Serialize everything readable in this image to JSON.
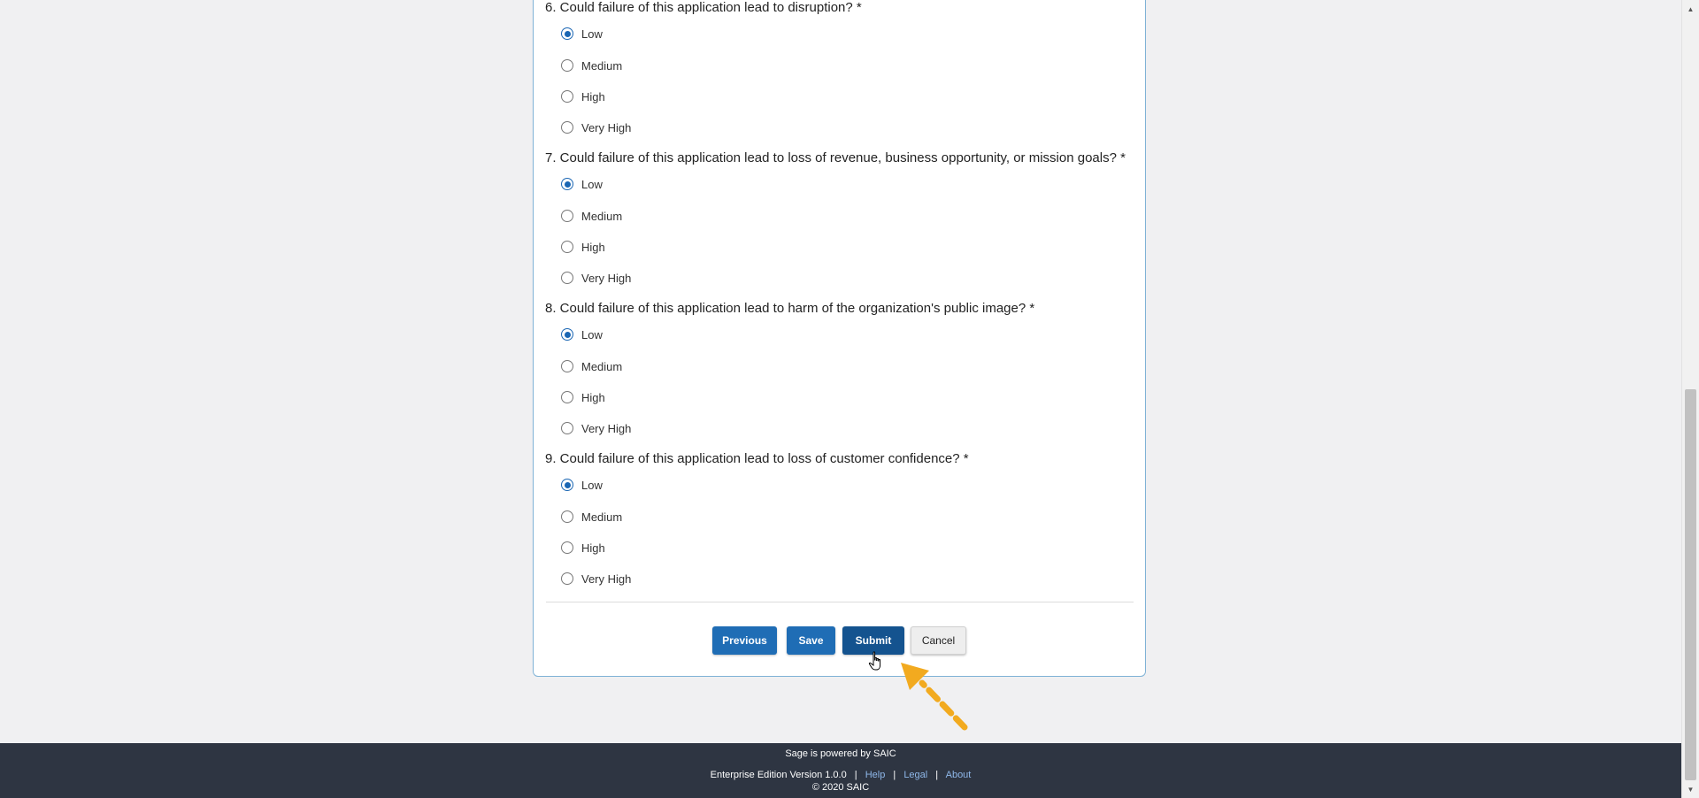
{
  "questions": [
    {
      "title": "6. Could failure of this application lead to disruption? *",
      "options": [
        "Low",
        "Medium",
        "High",
        "Very High"
      ],
      "selected": "Low"
    },
    {
      "title": "7. Could failure of this application lead to loss of revenue, business opportunity, or mission goals? *",
      "options": [
        "Low",
        "Medium",
        "High",
        "Very High"
      ],
      "selected": "Low"
    },
    {
      "title": "8. Could failure of this application lead to harm of the organization's public image? *",
      "options": [
        "Low",
        "Medium",
        "High",
        "Very High"
      ],
      "selected": "Low"
    },
    {
      "title": "9. Could failure of this application lead to loss of customer confidence? *",
      "options": [
        "Low",
        "Medium",
        "High",
        "Very High"
      ],
      "selected": "Low"
    }
  ],
  "buttons": {
    "previous": "Previous",
    "save": "Save",
    "submit": "Submit",
    "cancel": "Cancel"
  },
  "footer": {
    "powered_by": "Sage is powered by SAIC",
    "version": "Enterprise Edition Version 1.0.0",
    "separator": "|",
    "help": "Help",
    "legal": "Legal",
    "about": "About",
    "copyright": "© 2020 SAIC"
  },
  "colors": {
    "primary": "#1f6db5",
    "primary_active": "#14538f",
    "footer_bg": "#2e3542",
    "link": "#8fb8ea",
    "annotation_arrow": "#f2aa1f"
  },
  "icons": {
    "scroll_up": "scroll-up-arrow-icon",
    "scroll_down": "scroll-down-arrow-icon",
    "cursor": "hand-pointer-cursor-icon",
    "annotation": "dashed-arrow-icon"
  }
}
